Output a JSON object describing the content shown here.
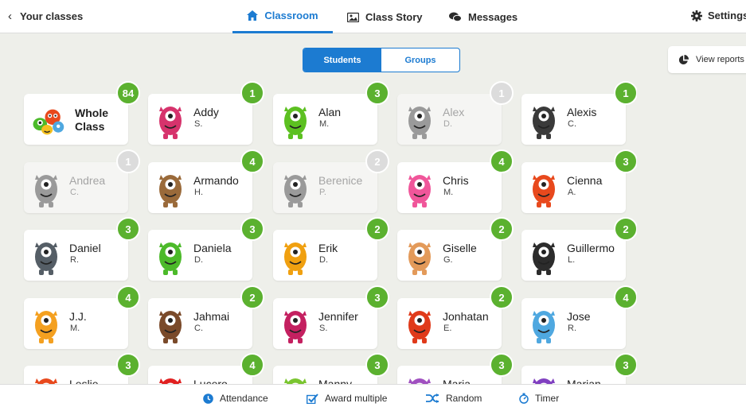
{
  "colors": {
    "accent": "#1c7bd1",
    "badge_green": "#5bb12f",
    "badge_grey": "#dcdcdc"
  },
  "header": {
    "back_label": "Your classes",
    "tabs": [
      {
        "label": "Classroom",
        "icon": "home-icon",
        "active": true
      },
      {
        "label": "Class Story",
        "icon": "photo-icon",
        "active": false
      },
      {
        "label": "Messages",
        "icon": "chat-icon",
        "active": false
      }
    ],
    "settings_label": "Settings"
  },
  "toggle": {
    "students": "Students",
    "groups": "Groups",
    "selected": "Students"
  },
  "view_reports": "View reports",
  "whole_class": {
    "line1": "Whole",
    "line2": "Class",
    "points": "84"
  },
  "students": [
    {
      "first": "Addy",
      "last": "S.",
      "points": "1",
      "absent": false
    },
    {
      "first": "Alan",
      "last": "M.",
      "points": "3",
      "absent": false
    },
    {
      "first": "Alex",
      "last": "D.",
      "points": "1",
      "absent": true
    },
    {
      "first": "Alexis",
      "last": "C.",
      "points": "1",
      "absent": false
    },
    {
      "first": "Andrea",
      "last": "C.",
      "points": "1",
      "absent": true
    },
    {
      "first": "Armando",
      "last": "H.",
      "points": "4",
      "absent": false
    },
    {
      "first": "Berenice",
      "last": "P.",
      "points": "2",
      "absent": true
    },
    {
      "first": "Chris",
      "last": "M.",
      "points": "4",
      "absent": false
    },
    {
      "first": "Cienna",
      "last": "A.",
      "points": "3",
      "absent": false
    },
    {
      "first": "Daniel",
      "last": "R.",
      "points": "3",
      "absent": false
    },
    {
      "first": "Daniela",
      "last": "D.",
      "points": "3",
      "absent": false
    },
    {
      "first": "Erik",
      "last": "D.",
      "points": "2",
      "absent": false
    },
    {
      "first": "Giselle",
      "last": "G.",
      "points": "2",
      "absent": false
    },
    {
      "first": "Guillermo",
      "last": "L.",
      "points": "2",
      "absent": false
    },
    {
      "first": "J.J.",
      "last": "M.",
      "points": "4",
      "absent": false
    },
    {
      "first": "Jahmai",
      "last": "C.",
      "points": "2",
      "absent": false
    },
    {
      "first": "Jennifer",
      "last": "S.",
      "points": "3",
      "absent": false
    },
    {
      "first": "Jonhatan",
      "last": "E.",
      "points": "2",
      "absent": false
    },
    {
      "first": "Jose",
      "last": "R.",
      "points": "4",
      "absent": false
    },
    {
      "first": "Leslie",
      "last": "",
      "points": "3",
      "absent": false
    },
    {
      "first": "Lucero",
      "last": "",
      "points": "4",
      "absent": false
    },
    {
      "first": "Manny",
      "last": "",
      "points": "3",
      "absent": false
    },
    {
      "first": "Maria",
      "last": "",
      "points": "3",
      "absent": false
    },
    {
      "first": "Marian",
      "last": "",
      "points": "3",
      "absent": false
    }
  ],
  "monster_colors": [
    "#d6336c",
    "#5cc021",
    "#8a8a8a",
    "#3a3a3a",
    "#8a8a8a",
    "#9a6a3a",
    "#a0a0a0",
    "#f0569a",
    "#e8491d",
    "#555e66",
    "#4cba2a",
    "#f0a010",
    "#e39a5a",
    "#2c2c2c",
    "#f4a020",
    "#7a4a2a",
    "#c42060",
    "#e03a1a",
    "#4fa8e0",
    "#e8491d",
    "#e02020",
    "#7ac530",
    "#a050c0",
    "#8040c0"
  ],
  "footer": [
    {
      "label": "Attendance",
      "icon": "clock-icon"
    },
    {
      "label": "Award multiple",
      "icon": "checkbox-icon"
    },
    {
      "label": "Random",
      "icon": "shuffle-icon"
    },
    {
      "label": "Timer",
      "icon": "stopwatch-icon"
    }
  ]
}
